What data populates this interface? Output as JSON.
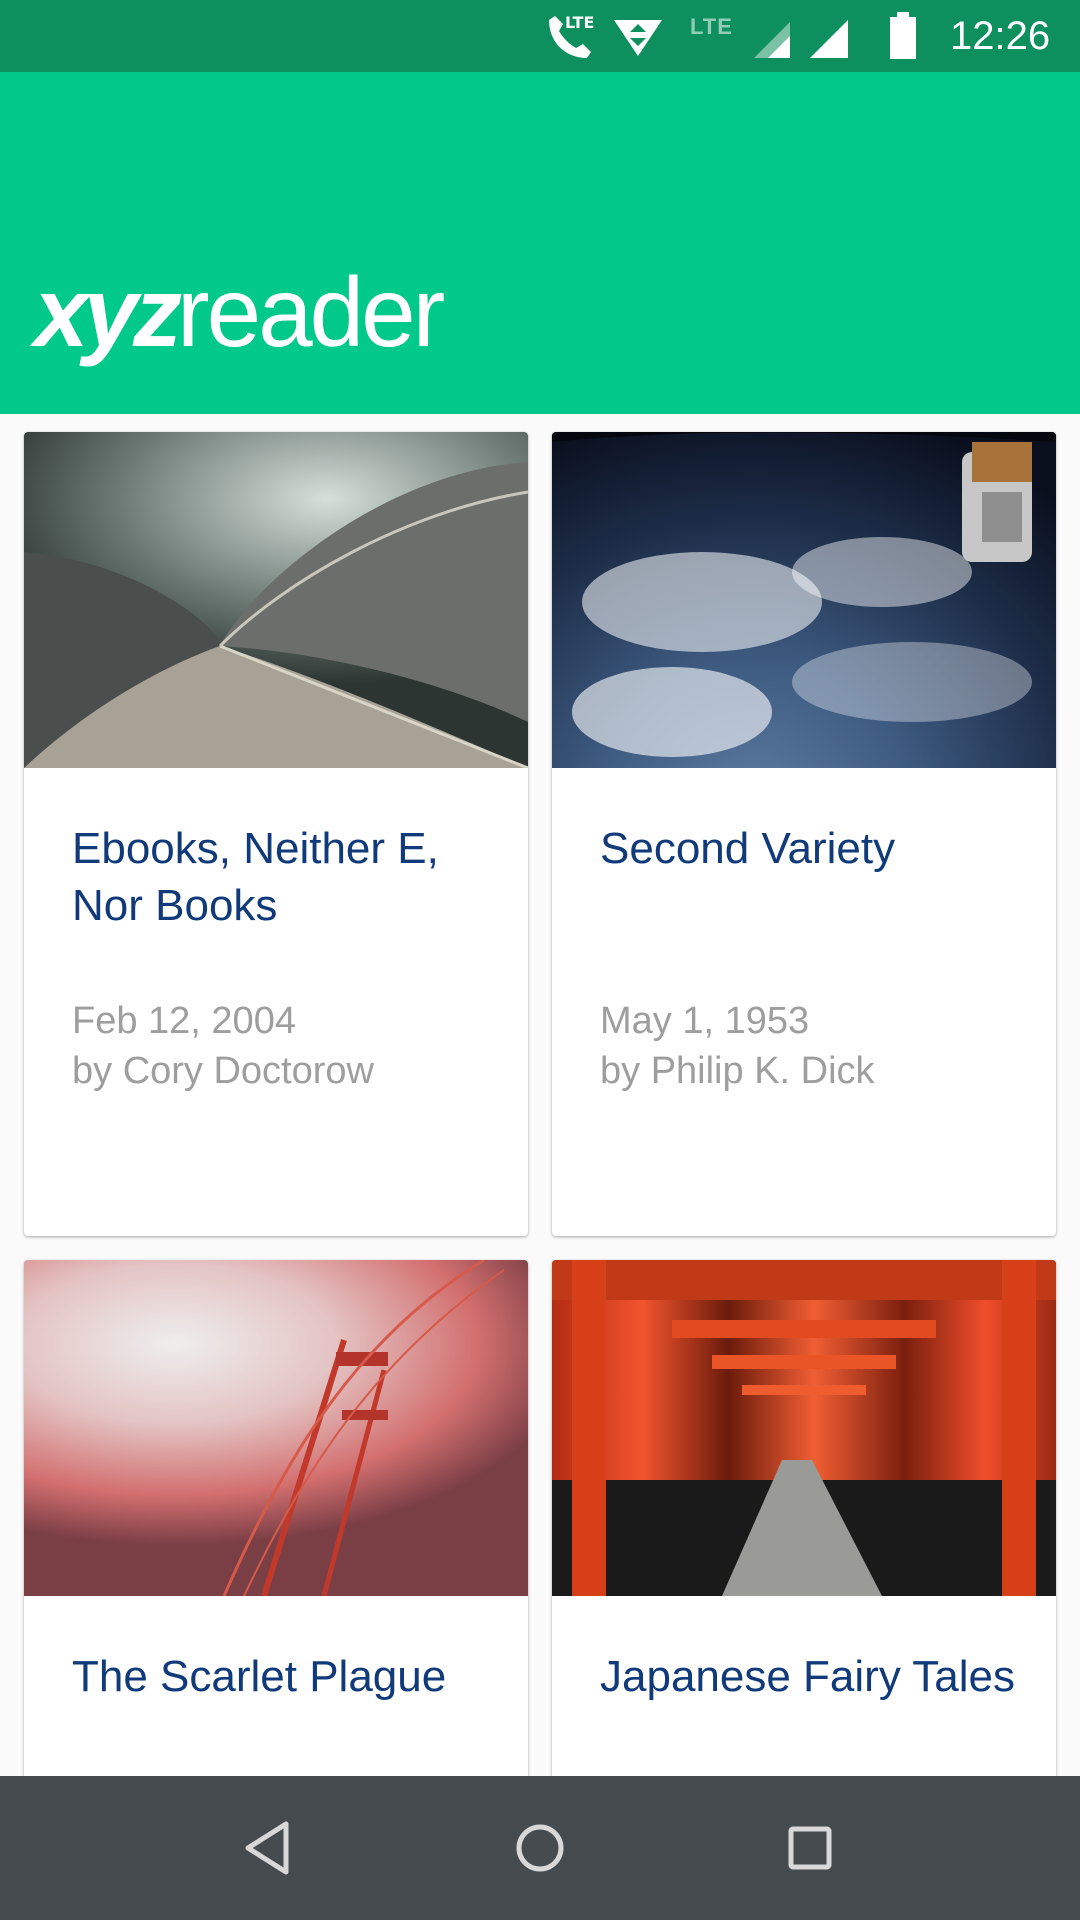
{
  "status_bar": {
    "network_label": "LTE",
    "secondary_network_label": "LTE",
    "time": "12:26"
  },
  "app_bar": {
    "logo_bold": "xyz",
    "logo_light": "reader"
  },
  "articles": [
    {
      "title": "Ebooks, Neither E, Nor Books",
      "date": "Feb 12, 2004",
      "author": "by Cory Doctorow",
      "thumbnail": "opera-house-image"
    },
    {
      "title": "Second Variety",
      "date": "May 1, 1953",
      "author": "by Philip K. Dick",
      "thumbnail": "earth-from-space-image"
    },
    {
      "title": "The Scarlet Plague",
      "date": "",
      "author": "",
      "thumbnail": "bridge-in-fog-image"
    },
    {
      "title": "Japanese Fairy Tales",
      "date": "",
      "author": "",
      "thumbnail": "torii-gates-image"
    }
  ],
  "colors": {
    "status_bar": "#0e8f5e",
    "app_bar": "#00c98a",
    "title_text": "#103a7a",
    "meta_text": "#9e9e9e",
    "nav_bar": "#464b50"
  },
  "nav_bar": {
    "back_icon": "back-icon",
    "home_icon": "home-icon",
    "recents_icon": "recents-icon"
  }
}
